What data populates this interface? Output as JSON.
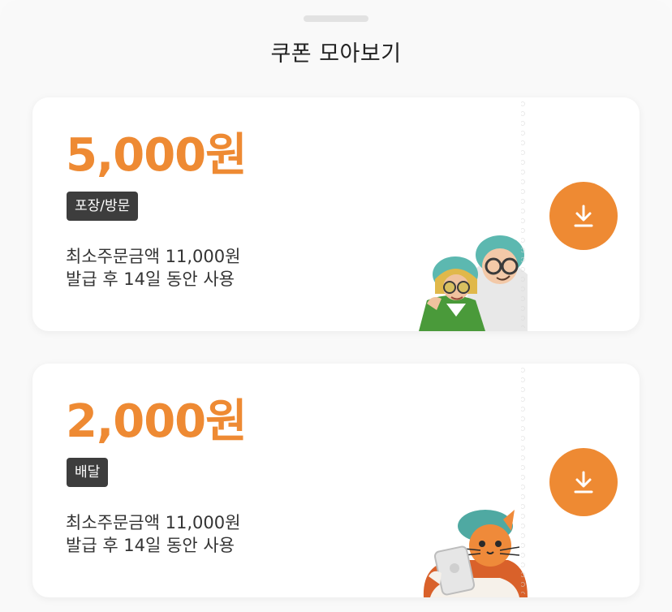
{
  "sheet": {
    "title": "쿠폰 모아보기"
  },
  "coupons": [
    {
      "amount": "5,000원",
      "tag": "포장/방문",
      "min_order": "최소주문금액 11,000원",
      "validity": "발급 후 14일 동안 사용",
      "illustration_icon": "two-characters-illustration",
      "download_icon": "download-icon"
    },
    {
      "amount": "2,000원",
      "tag": "배달",
      "min_order": "최소주문금액 11,000원",
      "validity": "발급 후 14일 동안 사용",
      "illustration_icon": "cat-with-tablet-illustration",
      "download_icon": "download-icon"
    }
  ],
  "colors": {
    "accent": "#ee8a33",
    "tag_bg": "#3d3d3d",
    "card_bg": "#ffffff",
    "sheet_bg": "#f9f9f9"
  }
}
